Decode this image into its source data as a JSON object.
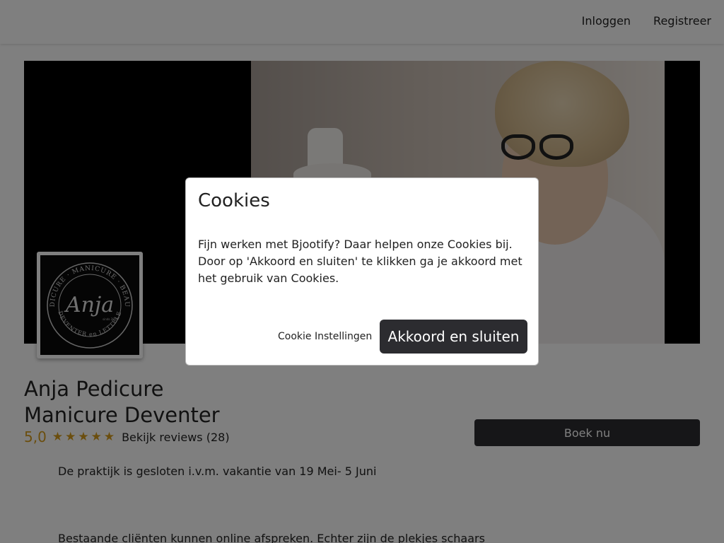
{
  "header": {
    "login_label": "Inloggen",
    "register_label": "Registreer"
  },
  "hero": {
    "logo": {
      "top_text": "PEDICURE · MANICURE · BEAUTY",
      "name": "Anja",
      "bottom_text": "DEVENTER en LETTELE",
      "since": "sinds 2010"
    }
  },
  "business": {
    "name_line1": "Anja Pedicure",
    "name_line2": "Manicure Deventer",
    "rating": "5,0",
    "stars": 5,
    "reviews_label": "Bekijk reviews (28)",
    "book_label": "Boek nu",
    "notice": "De praktijk is gesloten i.v.m. vakantie van 19 Mei- 5 Juni",
    "description": "Bestaande cliënten kunnen online afspreken. Echter zijn de plekjes schaars"
  },
  "cookie_modal": {
    "title": "Cookies",
    "body": "Fijn werken met Bjootify? Daar helpen onze Cookies bij. Door op 'Akkoord en sluiten' te klikken ga je akkoord met het gebruik van Cookies.",
    "settings_label": "Cookie Instellingen",
    "accept_label": "Akkoord en sluiten"
  },
  "colors": {
    "accent_gold": "#d79d1d",
    "button_dark": "#2c2c30",
    "overlay": "rgba(0,0,0,0.5)"
  },
  "icons": {
    "star": "star-icon"
  }
}
